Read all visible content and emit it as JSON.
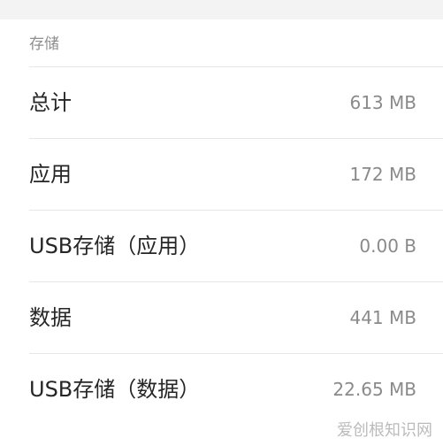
{
  "section": {
    "title": "存储"
  },
  "rows": [
    {
      "label": "总计",
      "value": "613 MB"
    },
    {
      "label": "应用",
      "value": "172 MB"
    },
    {
      "label": "USB存储（应用）",
      "value": "0.00 B"
    },
    {
      "label": "数据",
      "value": "441 MB"
    },
    {
      "label": "USB存储（数据）",
      "value": "22.65 MB"
    }
  ],
  "watermark": {
    "text": "爱创根知识网"
  },
  "colors": {
    "background": "#f3f3f3",
    "panel": "#ffffff",
    "label": "#262626",
    "value": "#8a8a8a",
    "header": "#8e8e8e",
    "divider": "#e6e6e6"
  }
}
